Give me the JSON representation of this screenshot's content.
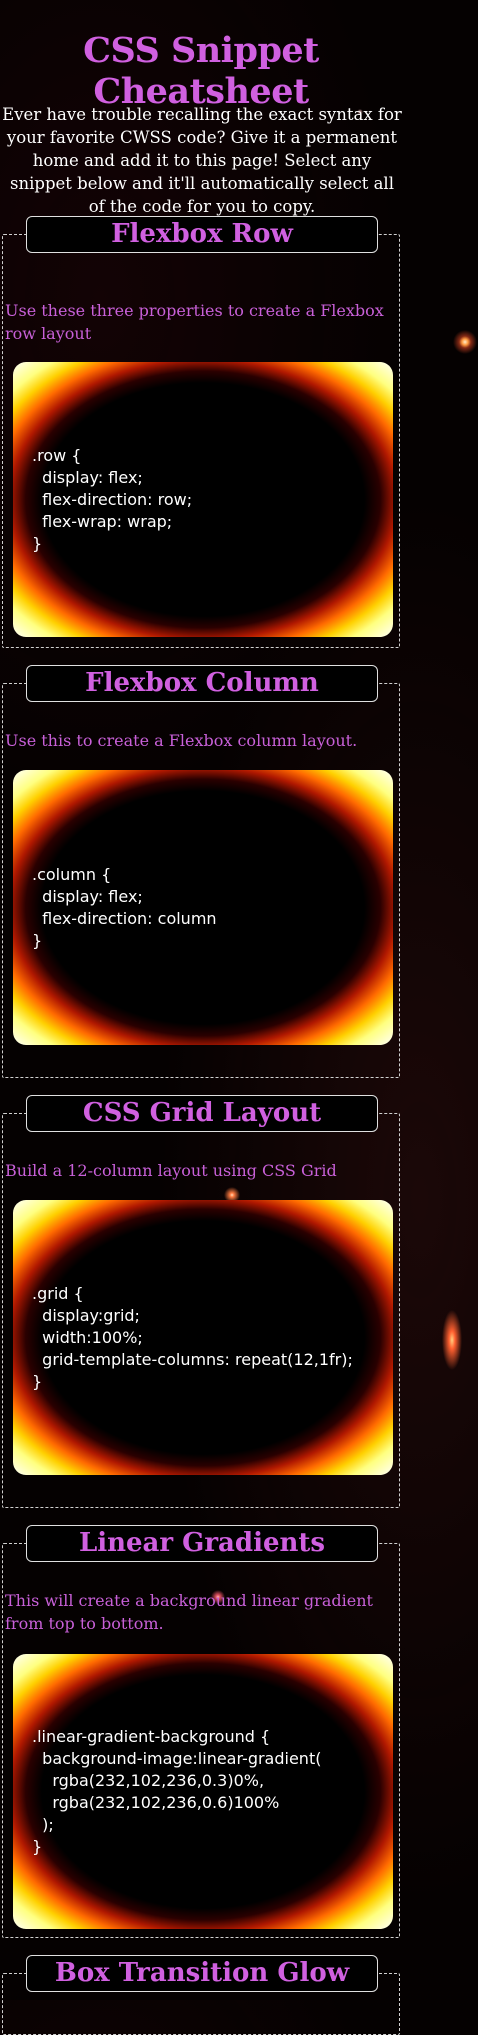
{
  "header": {
    "title": "CSS Snippet Cheatsheet",
    "intro": "Ever have trouble recalling the exact syntax for your favorite CWSS code? Give it a permanent home and add it to this page! Select any snippet below and it'll automatically select all of the code for you to copy."
  },
  "sections": [
    {
      "title": "Flexbox Row",
      "description": "Use these three properties to create a Flexbox row layout",
      "code": ".row {\n  display: flex;\n  flex-direction: row;\n  flex-wrap: wrap;\n}"
    },
    {
      "title": "Flexbox Column",
      "description": "Use this to create a Flexbox column layout.",
      "code": ".column {\n  display: flex;\n  flex-direction: column\n}"
    },
    {
      "title": "CSS Grid Layout",
      "description": "Build a 12-column layout using CSS Grid",
      "code": ".grid {\n  display:grid;\n  width:100%;\n  grid-template-columns: repeat(12,1fr);\n}"
    },
    {
      "title": "Linear Gradients",
      "description": "This will create a background linear gradient from top to bottom.",
      "code": ".linear-gradient-background {\n  background-image:linear-gradient(\n    rgba(232,102,236,0.3)0%,\n    rgba(232,102,236,0.6)100%\n  );\n}"
    },
    {
      "title": "Box Transition Glow"
    }
  ],
  "colors": {
    "accent": "#d060e0",
    "background": "#050101",
    "code_text": "#ffffff"
  }
}
